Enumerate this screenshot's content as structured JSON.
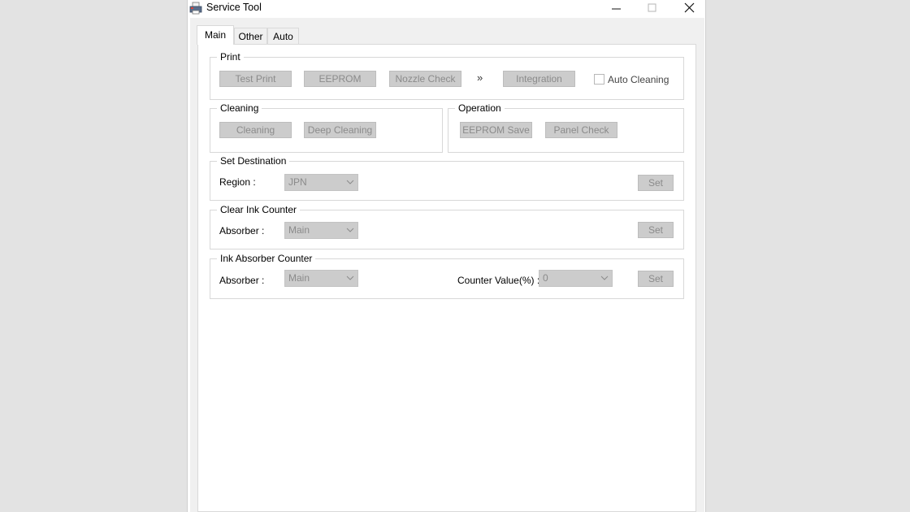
{
  "window": {
    "title": "Service Tool",
    "controls": {
      "minimize": "—",
      "maximize": "☐",
      "close": "✕"
    }
  },
  "tabs": [
    {
      "label": "Main",
      "active": true
    },
    {
      "label": "Other",
      "active": false
    },
    {
      "label": "Auto",
      "active": false
    }
  ],
  "print": {
    "legend": "Print",
    "test_print": "Test Print",
    "eeprom": "EEPROM",
    "nozzle_check": "Nozzle Check",
    "arrows": "»",
    "integration": "Integration",
    "auto_cleaning": "Auto Cleaning",
    "auto_cleaning_checked": false
  },
  "cleaning": {
    "legend": "Cleaning",
    "cleaning": "Cleaning",
    "deep_cleaning": "Deep Cleaning"
  },
  "operation": {
    "legend": "Operation",
    "eeprom_save": "EEPROM Save",
    "panel_check": "Panel Check"
  },
  "set_destination": {
    "legend": "Set Destination",
    "region_label": "Region :",
    "region_value": "JPN",
    "set": "Set"
  },
  "clear_ink_counter": {
    "legend": "Clear Ink Counter",
    "absorber_label": "Absorber :",
    "absorber_value": "Main",
    "set": "Set"
  },
  "ink_absorber_counter": {
    "legend": "Ink Absorber Counter",
    "absorber_label": "Absorber :",
    "absorber_value": "Main",
    "counter_label": "Counter Value(%) :",
    "counter_value": "0",
    "set": "Set"
  },
  "colors": {
    "disabled_button": "#cccccc",
    "disabled_text": "#8b8b8b",
    "panel": "#f0f0f0",
    "border": "#d8d8d8"
  }
}
